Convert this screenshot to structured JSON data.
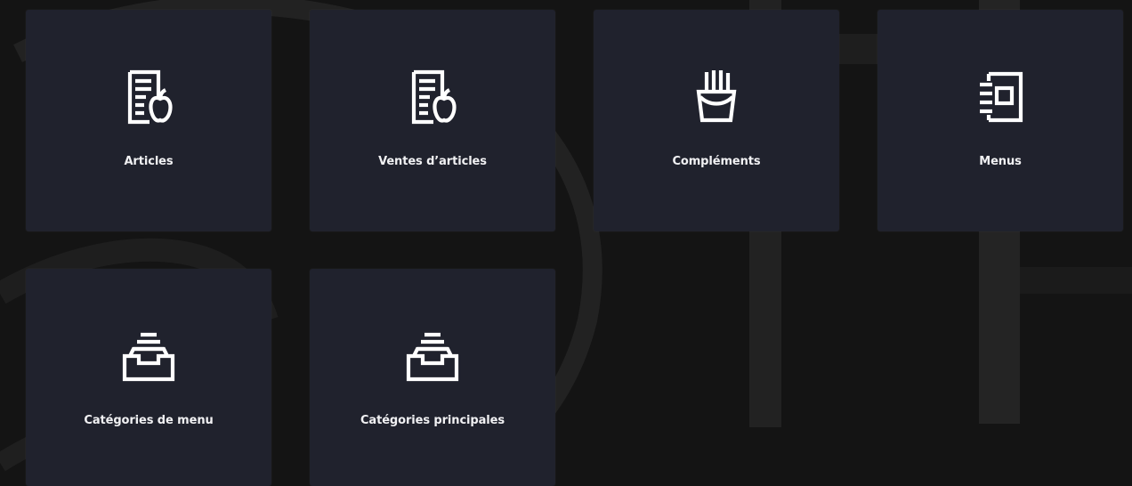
{
  "background": {
    "color": "#141414",
    "accent_color": "#2b2b2b"
  },
  "tiles": [
    {
      "label": "Articles",
      "icon": "article-apple-icon"
    },
    {
      "label": "Ventes d’articles",
      "icon": "article-apple-icon"
    },
    {
      "label": "Compléments",
      "icon": "fries-icon"
    },
    {
      "label": "Menus",
      "icon": "menu-book-icon"
    },
    {
      "label": "Catégories de menu",
      "icon": "inbox-tray-icon"
    },
    {
      "label": "Catégories principales",
      "icon": "inbox-tray-icon"
    }
  ],
  "colors": {
    "tile_bg": "#20222d",
    "tile_text": "#f1f1f3",
    "icon": "#ffffff"
  }
}
